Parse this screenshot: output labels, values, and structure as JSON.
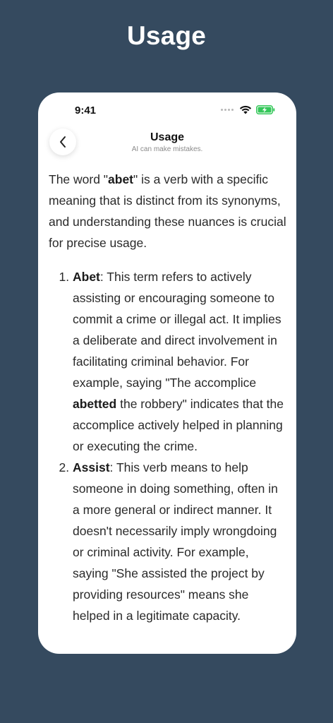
{
  "header": {
    "page_title": "Usage"
  },
  "status_bar": {
    "time": "9:41"
  },
  "nav": {
    "title": "Usage",
    "subtitle": "AI can make mistakes."
  },
  "content": {
    "intro": {
      "before": "The word \"",
      "term": "abet",
      "after": "\" is a verb with a specific meaning that is distinct from its synonyms, and understanding these nuances is crucial for precise usage."
    },
    "items": [
      {
        "term": "Abet",
        "text_before": ": This term refers to actively assisting or encouraging someone to commit a crime or illegal act. It implies a deliberate and direct involvement in facilitating criminal behavior. For example, saying \"The accomplice ",
        "bold_word": "abetted",
        "text_after": " the robbery\" indicates that the accomplice actively helped in planning or executing the crime."
      },
      {
        "term": "Assist",
        "text_before": ": This verb means to help someone in doing something, often in a more general or indirect manner. It doesn't necessarily imply wrongdoing or criminal activity. For example, saying \"She assisted the project by providing resources\" means she helped in a legitimate capacity.",
        "bold_word": "",
        "text_after": ""
      }
    ]
  },
  "colors": {
    "background": "#354a5f",
    "card": "#ffffff",
    "battery": "#34c759"
  },
  "icons": {
    "back": "chevron-left-icon",
    "wifi": "wifi-icon",
    "battery": "battery-charging-icon",
    "signal": "signal-dots-icon"
  }
}
